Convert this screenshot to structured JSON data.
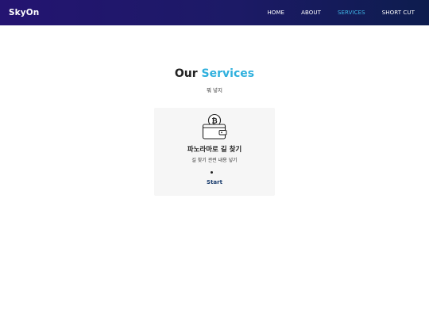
{
  "navbar": {
    "brand": "SkyOn",
    "items": [
      {
        "label": "HOME",
        "active": false
      },
      {
        "label": "ABOUT",
        "active": false
      },
      {
        "label": "SERVICES",
        "active": true
      },
      {
        "label": "SHORT CUT",
        "active": false
      }
    ]
  },
  "services": {
    "title_prefix": "Our",
    "title_accent": "Services",
    "subtitle": "뭐 넣지",
    "cards": [
      {
        "icon": "wallet-icon",
        "title": "파노라마로 길 찾기",
        "description": "길 찾기 관련 내용 넣기",
        "link_label": "Start"
      }
    ]
  },
  "colors": {
    "nav_gradient_start": "#241471",
    "nav_gradient_end": "#0d1c4e",
    "accent": "#2fb0dd",
    "active_nav": "#3fb6e6",
    "card_background": "#f6f6f6",
    "link": "#173a6b"
  }
}
